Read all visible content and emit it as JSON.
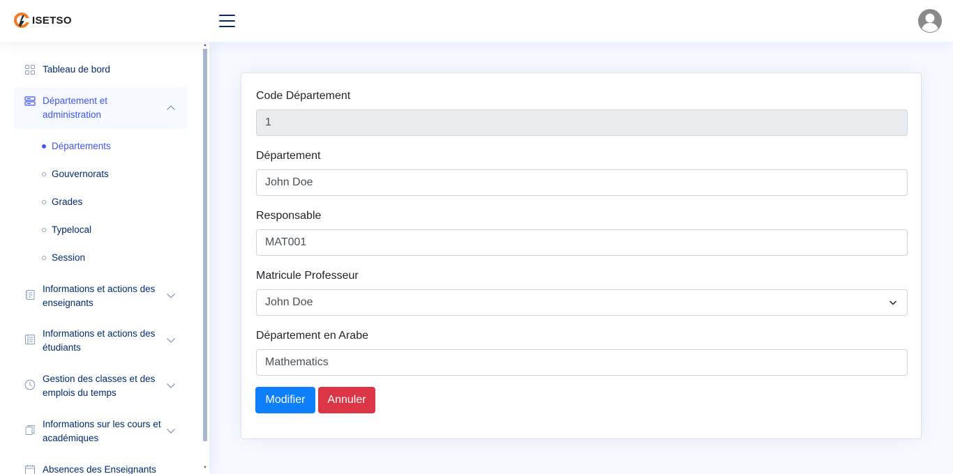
{
  "app": {
    "logo_text": "ISETSO"
  },
  "sidebar": {
    "dashboard": "Tableau de bord",
    "department_group": "Département et administration",
    "sub_items": [
      "Départements",
      "Gouvernorats",
      "Grades",
      "Typelocal",
      "Session"
    ],
    "teachers": "Informations et actions des enseignants",
    "students": "Informations et actions des étudiants",
    "classes": "Gestion des classes et des emplois du temps",
    "courses": "Informations sur les cours et académiques",
    "absences": "Absences des Enseignants"
  },
  "form": {
    "code_label": "Code Département",
    "code_value": "1",
    "dept_label": "Département",
    "dept_value": "John Doe",
    "resp_label": "Responsable",
    "resp_value": "MAT001",
    "matricule_label": "Matricule Professeur",
    "matricule_value": "John Doe",
    "arabe_label": "Département en Arabe",
    "arabe_value": "Mathematics",
    "submit_label": "Modifier",
    "cancel_label": "Annuler"
  },
  "colors": {
    "primary": "#0d7ffb",
    "danger": "#dc3545",
    "accent": "#4154f1",
    "nav": "#012970"
  }
}
